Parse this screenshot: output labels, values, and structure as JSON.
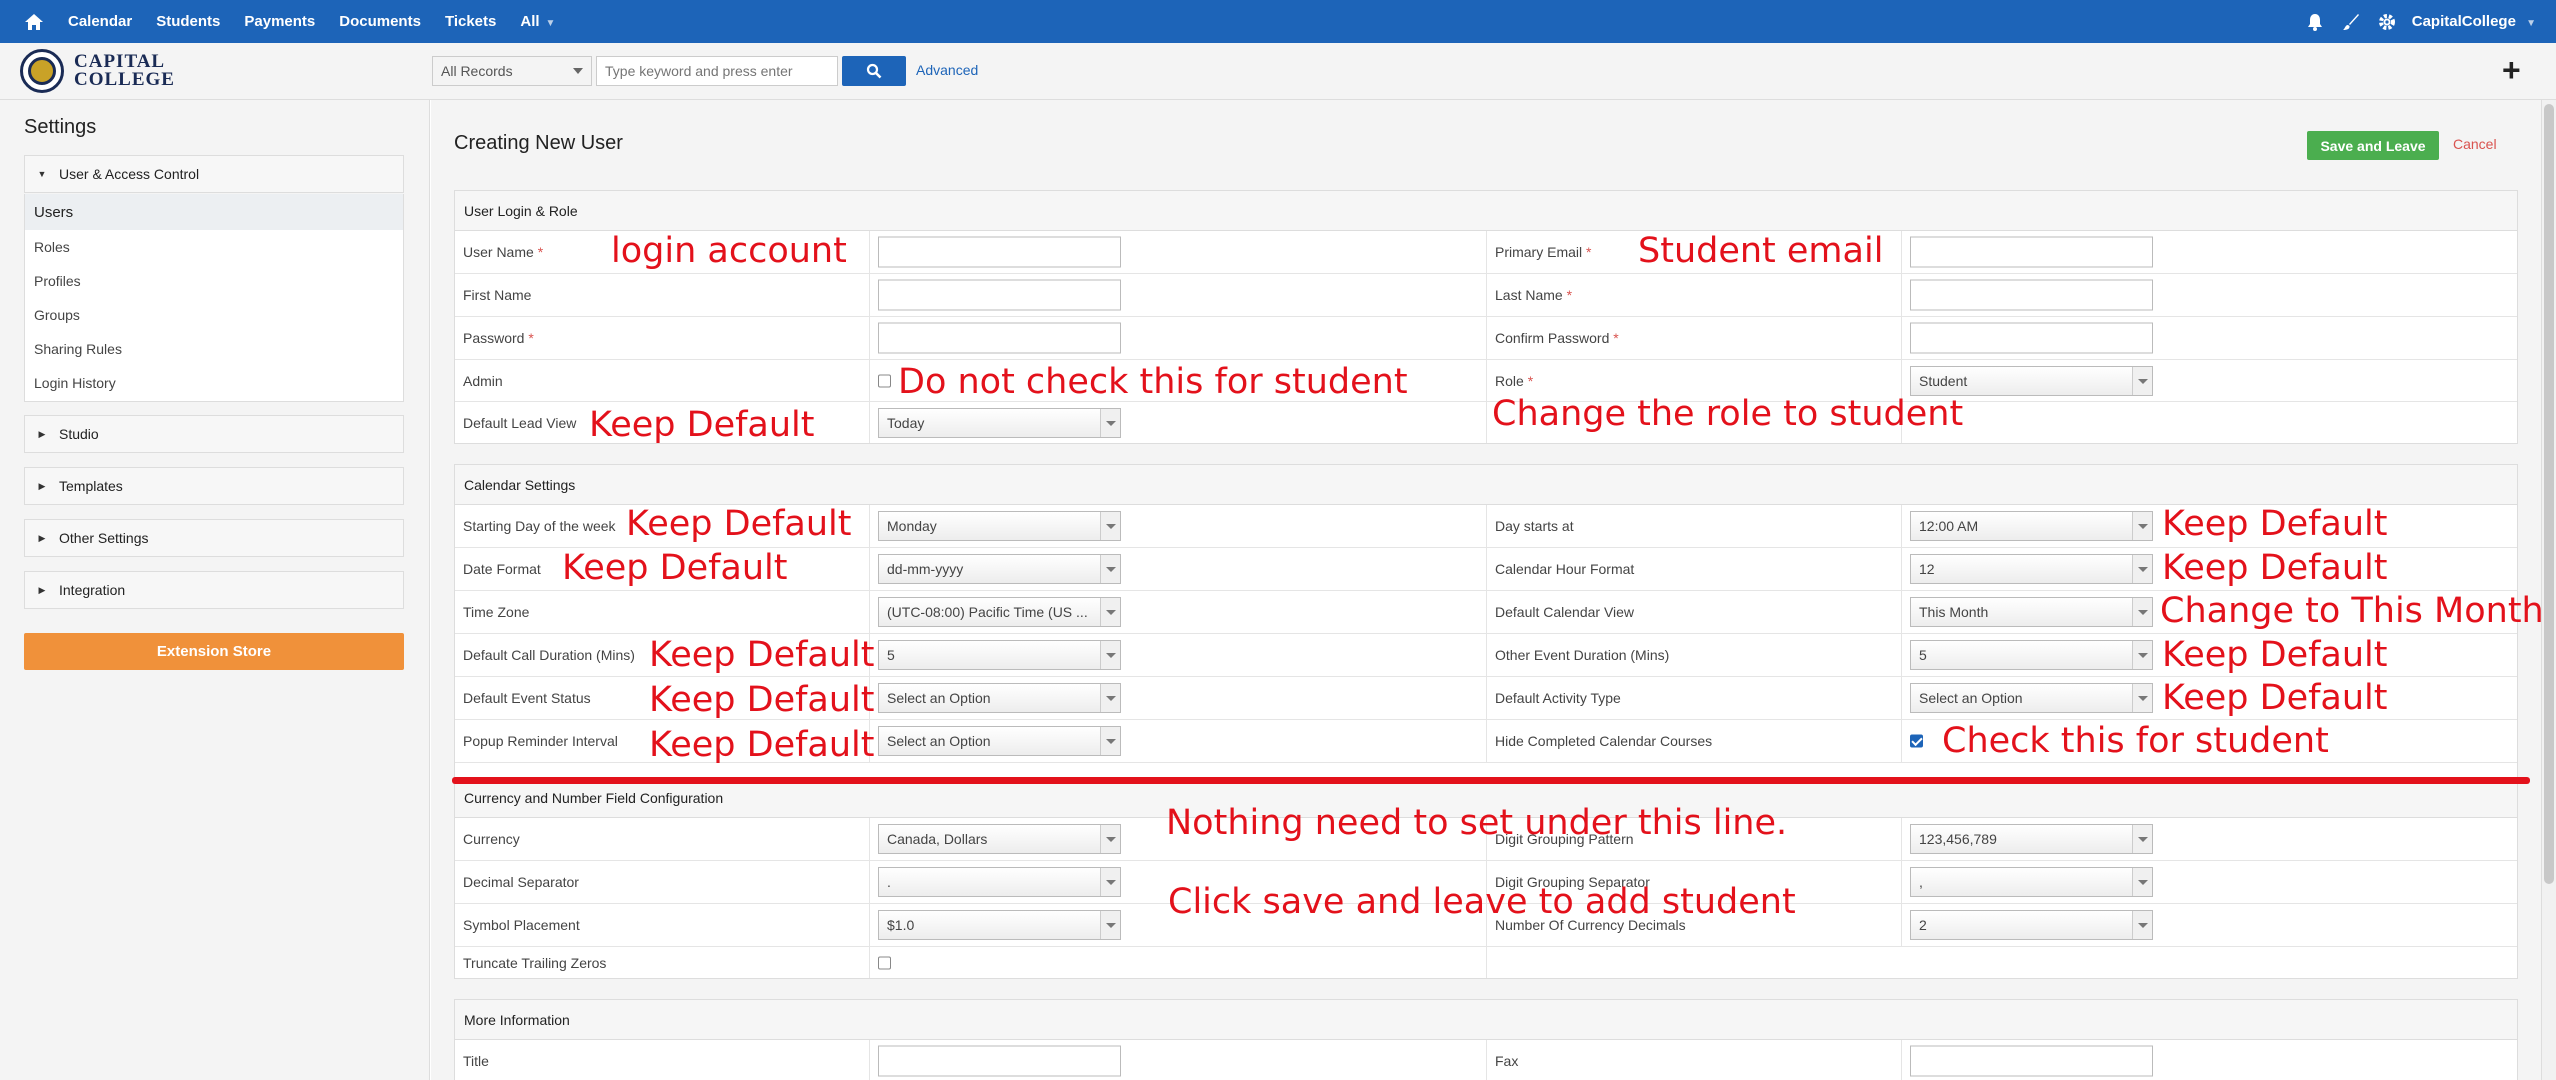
{
  "topnav": {
    "items": [
      "Calendar",
      "Students",
      "Payments",
      "Documents",
      "Tickets",
      "All"
    ],
    "account": "CapitalCollege"
  },
  "logo": {
    "line1": "CAPITAL",
    "line2": "COLLEGE"
  },
  "search": {
    "records": "All Records",
    "placeholder": "Type keyword and press enter",
    "advanced": "Advanced"
  },
  "sidebar": {
    "title": "Settings",
    "sections": [
      "User & Access Control",
      "Studio",
      "Templates",
      "Other Settings",
      "Integration"
    ],
    "subitems": [
      "Users",
      "Roles",
      "Profiles",
      "Groups",
      "Sharing Rules",
      "Login History"
    ],
    "extension": "Extension Store"
  },
  "page": {
    "title": "Creating New User",
    "save": "Save and Leave",
    "cancel": "Cancel"
  },
  "login_block": {
    "header": "User Login & Role",
    "user_name": "User Name",
    "primary_email": "Primary Email",
    "first_name": "First Name",
    "last_name": "Last Name",
    "password": "Password",
    "confirm_password": "Confirm Password",
    "admin": "Admin",
    "role": "Role",
    "role_value": "Student",
    "default_lead_view": "Default Lead View",
    "lead_view_value": "Today"
  },
  "calendar_block": {
    "header": "Calendar Settings",
    "rows": [
      {
        "l1": "Starting Day of the week",
        "v1": "Monday",
        "l2": "Day starts at",
        "v2": "12:00 AM"
      },
      {
        "l1": "Date Format",
        "v1": "dd-mm-yyyy",
        "l2": "Calendar Hour Format",
        "v2": "12"
      },
      {
        "l1": "Time Zone",
        "v1": "(UTC-08:00) Pacific Time (US ...",
        "l2": "Default Calendar View",
        "v2": "This Month"
      },
      {
        "l1": "Default Call Duration (Mins)",
        "v1": "5",
        "l2": "Other Event Duration (Mins)",
        "v2": "5"
      },
      {
        "l1": "Default Event Status",
        "v1": "Select an Option",
        "l2": "Default Activity Type",
        "v2": "Select an Option"
      },
      {
        "l1": "Popup Reminder Interval",
        "v1": "Select an Option",
        "l2": "Hide Completed Calendar Courses",
        "v2": ""
      }
    ]
  },
  "currency_block": {
    "header": "Currency and Number Field Configuration",
    "rows": [
      {
        "l1": "Currency",
        "v1": "Canada, Dollars",
        "l2": "Digit Grouping Pattern",
        "v2": "123,456,789"
      },
      {
        "l1": "Decimal Separator",
        "v1": ".",
        "l2": "Digit Grouping Separator",
        "v2": ","
      },
      {
        "l1": "Symbol Placement",
        "v1": "$1.0",
        "l2": "Number Of Currency Decimals",
        "v2": "2"
      }
    ],
    "truncate": "Truncate Trailing Zeros"
  },
  "more_block": {
    "header": "More Information",
    "title": "Title",
    "fax": "Fax"
  },
  "annotations": {
    "login_account": "login account",
    "student_email": "Student email",
    "do_not_check": "Do not check this for student",
    "change_role": "Change the role to student",
    "keep_default": "Keep Default",
    "change_month": "Change to This Month",
    "check_this": "Check this for student",
    "nothing": "Nothing need to set under this line.",
    "click_save": "Click save and leave to add student"
  },
  "colors": {
    "nav": "#1d64b8",
    "save": "#4bae4f",
    "extension": "#f0913a",
    "annotation": "#e3111b"
  }
}
